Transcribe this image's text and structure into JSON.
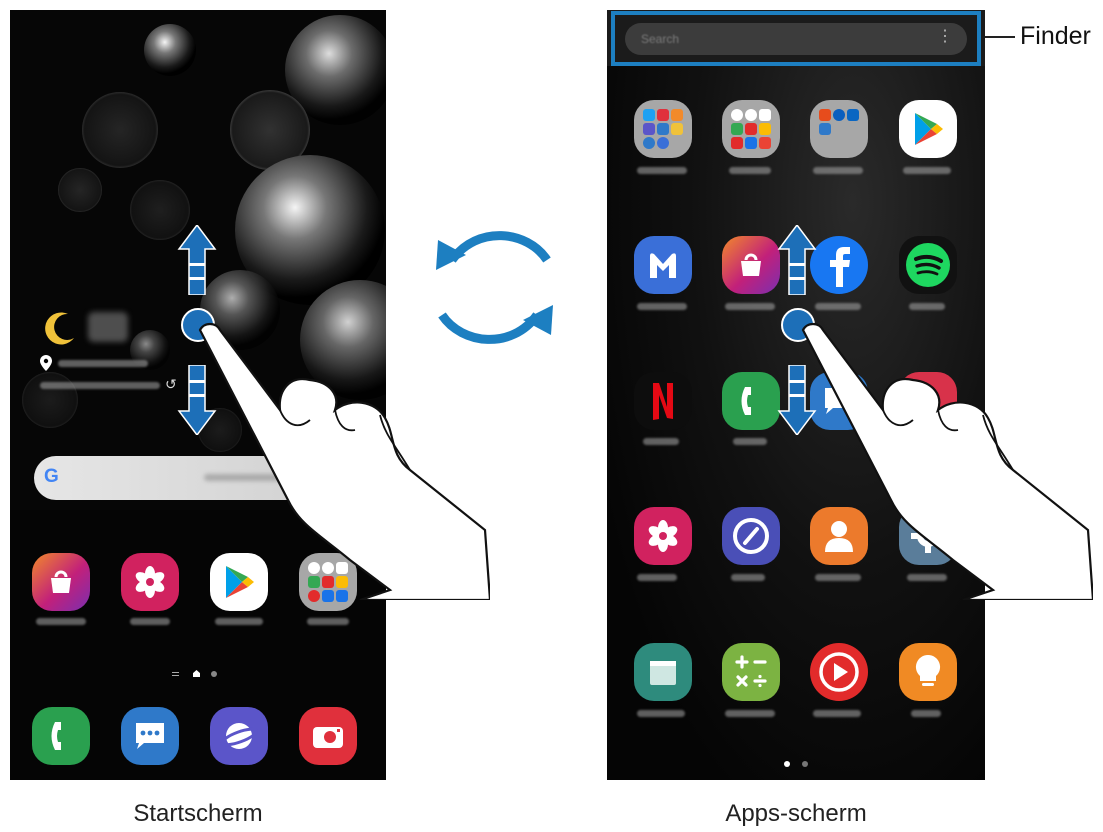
{
  "captions": {
    "home": "Startscherm",
    "apps": "Apps-scherm"
  },
  "finder": {
    "label": "Finder",
    "placeholder": "Search",
    "menu_icon": "more-vert-icon"
  },
  "home_screen": {
    "weather_icon": "moon-icon",
    "location_icon": "location-pin-icon",
    "refresh_icon": "refresh-icon",
    "search_widget_logo": "G",
    "app_row": [
      {
        "name": "galaxy-store-app",
        "icon": "shopping-bag-icon",
        "color": "#c2207a"
      },
      {
        "name": "gallery-app",
        "icon": "flower-icon",
        "color": "#d1225f"
      },
      {
        "name": "play-store-app",
        "icon": "play-triangle-icon",
        "color": "#ffffff"
      },
      {
        "name": "google-folder",
        "icon": "folder-icon",
        "color": "#a7a7a7"
      }
    ],
    "dock": [
      {
        "name": "phone-app",
        "icon": "phone-icon",
        "color": "#2aa04f"
      },
      {
        "name": "messages-app",
        "icon": "chat-bubble-icon",
        "color": "#2f79c9"
      },
      {
        "name": "internet-app",
        "icon": "planet-icon",
        "color": "#5b55c9"
      },
      {
        "name": "camera-app",
        "icon": "camera-icon",
        "color": "#e0303c"
      }
    ],
    "page_indicator": {
      "pages": 3,
      "current": 2
    }
  },
  "apps_screen": {
    "page_indicator": {
      "pages": 2,
      "current": 1
    },
    "grid": [
      [
        {
          "name": "samsung-folder",
          "icon": "folder-icon",
          "color": "#a7a7a7"
        },
        {
          "name": "google-folder",
          "icon": "folder-icon",
          "color": "#a7a7a7"
        },
        {
          "name": "microsoft-folder",
          "icon": "folder-icon",
          "color": "#a7a7a7"
        },
        {
          "name": "play-store-app",
          "icon": "play-triangle-icon",
          "color": "#ffffff"
        }
      ],
      [
        {
          "name": "samsung-members-app",
          "icon": "m-icon",
          "color": "#3a6fd8"
        },
        {
          "name": "galaxy-store-app",
          "icon": "shopping-bag-icon",
          "color": "#c2207a"
        },
        {
          "name": "facebook-app",
          "icon": "facebook-icon",
          "color": "#1877f2"
        },
        {
          "name": "spotify-app",
          "icon": "spotify-icon",
          "color": "#111111"
        }
      ],
      [
        {
          "name": "netflix-app",
          "icon": "netflix-icon",
          "color": "#0d0d0d"
        },
        {
          "name": "phone-app",
          "icon": "phone-icon",
          "color": "#2aa04f"
        },
        {
          "name": "messages-app",
          "icon": "chat-bubble-icon",
          "color": "#2f79c9"
        },
        {
          "name": "red-app",
          "icon": "app-icon",
          "color": "#d8324a"
        }
      ],
      [
        {
          "name": "gallery-app",
          "icon": "flower-icon",
          "color": "#d1225f"
        },
        {
          "name": "clock-app",
          "icon": "clock-icon",
          "color": "#4a4fb7"
        },
        {
          "name": "contacts-app",
          "icon": "person-icon",
          "color": "#ec7a2c"
        },
        {
          "name": "settings-app",
          "icon": "gear-icon",
          "color": "#5a7d9a"
        }
      ],
      [
        {
          "name": "calendar-app",
          "icon": "calendar-icon",
          "color": "#2e8b7d"
        },
        {
          "name": "calculator-app",
          "icon": "calculator-icon",
          "color": "#7cb342"
        },
        {
          "name": "youtube-music-app",
          "icon": "play-circle-icon",
          "color": "#e22b2b"
        },
        {
          "name": "tips-app",
          "icon": "lightbulb-icon",
          "color": "#f08a24"
        }
      ]
    ]
  },
  "gesture": {
    "icon": "swipe-hand-icon",
    "arrow_color": "#1d6fb8",
    "swap_arrows_color": "#1d7fc1"
  }
}
